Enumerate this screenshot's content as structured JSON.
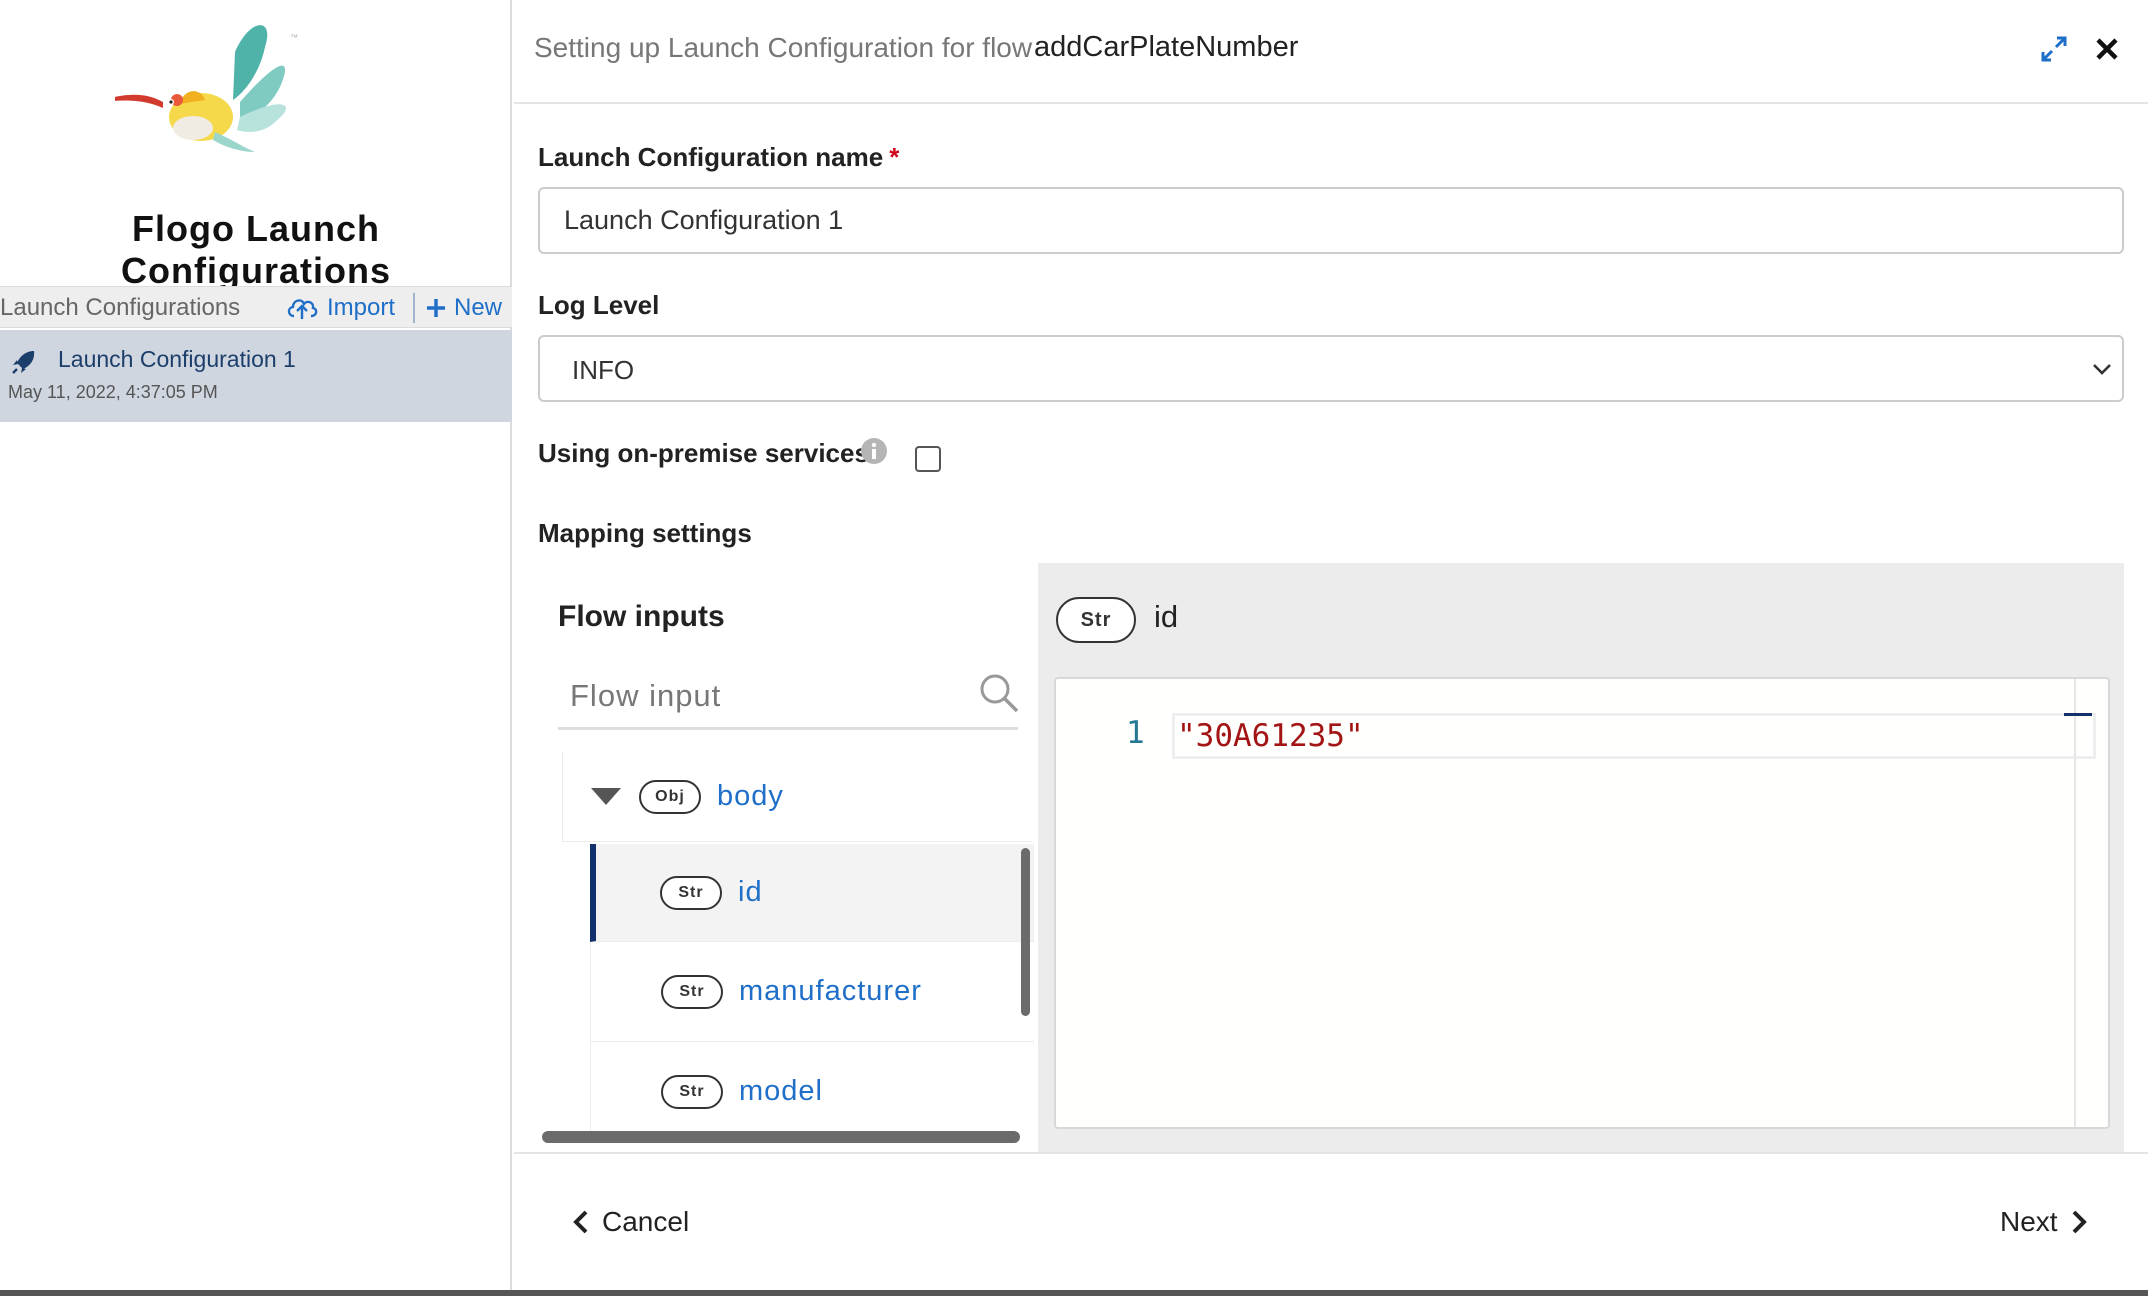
{
  "sidebar": {
    "app_title": "Flogo Launch Configurations",
    "header_label": "Launch Configurations",
    "import_label": "Import",
    "new_label": "New",
    "items": [
      {
        "name": "Launch Configuration 1",
        "date": "May 11, 2022, 4:37:05 PM"
      }
    ]
  },
  "header": {
    "title": "Setting up Launch Configuration for flow",
    "flow_name": "addCarPlateNumber"
  },
  "form": {
    "name_label": "Launch Configuration name",
    "required_mark": "*",
    "name_value": "Launch Configuration 1",
    "log_level_label": "Log Level",
    "log_level_value": "INFO",
    "on_premise_label": "Using on-premise services",
    "on_premise_checked": false,
    "mapping_label": "Mapping settings"
  },
  "mapping": {
    "flow_inputs_title": "Flow inputs",
    "search_placeholder": "Flow input",
    "tree": [
      {
        "type": "Obj",
        "name": "body",
        "expanded": true
      },
      {
        "type": "Str",
        "name": "id",
        "selected": true
      },
      {
        "type": "Str",
        "name": "manufacturer"
      },
      {
        "type": "Str",
        "name": "model"
      }
    ],
    "editor": {
      "type": "Str",
      "field": "id",
      "line_number": "1",
      "value": "\"30A61235\""
    }
  },
  "footer": {
    "cancel_label": "Cancel",
    "next_label": "Next"
  },
  "colors": {
    "link_blue": "#1f6fc9",
    "selected_bar": "#12306b",
    "sidebar_selected": "#cfd6df",
    "string_red": "#a31515"
  }
}
